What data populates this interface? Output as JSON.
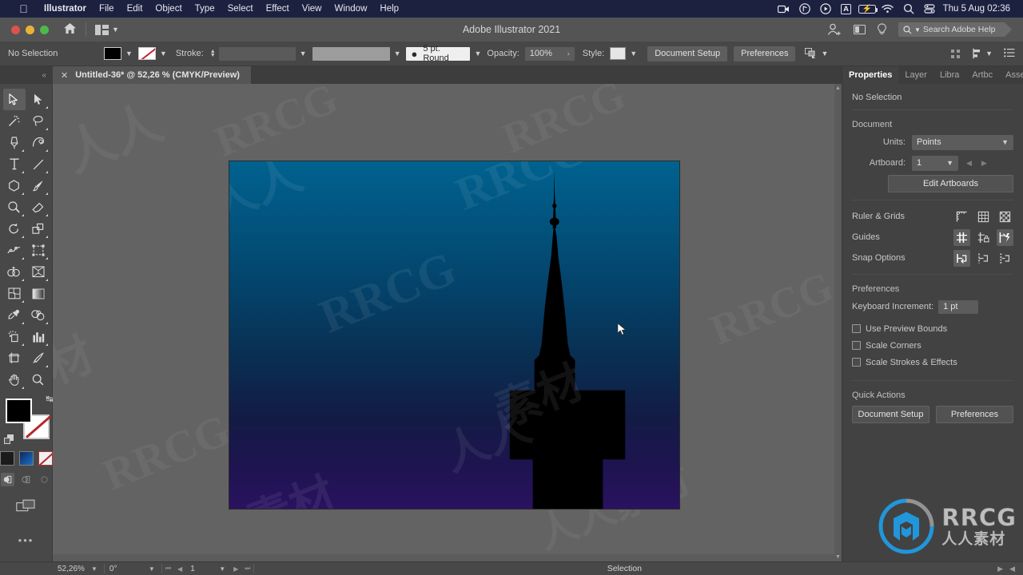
{
  "macbar": {
    "apple_icon": "apple-logo",
    "menus": [
      "Illustrator",
      "File",
      "Edit",
      "Object",
      "Type",
      "Select",
      "Effect",
      "View",
      "Window",
      "Help"
    ],
    "status_icons": [
      "screen-record-icon",
      "music-app-icon",
      "play-circle-icon",
      "input-source-a-icon",
      "battery-charging-icon",
      "wifi-icon",
      "spotlight-search-icon",
      "control-center-icon"
    ],
    "clock": "Thu 5 Aug  02:36"
  },
  "titlebar": {
    "window_controls": [
      "close-button",
      "minimize-button",
      "zoom-button"
    ],
    "home_icon": "home-icon",
    "arrange_icon": "arrange-documents-icon",
    "title": "Adobe Illustrator 2021",
    "account_icon": "account-add-icon",
    "workspace_icon": "workspace-switcher-icon",
    "tips_icon": "lightbulb-icon",
    "search_placeholder": "Search Adobe Help",
    "search_value": ""
  },
  "controlbar": {
    "selection_status": "No Selection",
    "fill_swatch": "#000000",
    "stroke_swatch": "none",
    "stroke_label": "Stroke:",
    "stroke_weight": "",
    "stroke_profile": "",
    "brush_label": "5 pt. Round",
    "opacity_label": "Opacity:",
    "opacity_value": "100%",
    "style_label": "Style:",
    "document_setup_button": "Document Setup",
    "preferences_button": "Preferences",
    "align_icon": "align-objects-icon",
    "arrange_icon": "arrange-icon",
    "more_options_icon": "more-options-icon"
  },
  "tabbar": {
    "close_icon": "close-tab-icon",
    "doc_title": "Untitled-36* @ 52,26 % (CMYK/Preview)"
  },
  "toolbar": {
    "tools": [
      {
        "name": "selection-tool",
        "active": true
      },
      {
        "name": "direct-selection-tool",
        "active": false
      },
      {
        "name": "magic-wand-tool",
        "active": false
      },
      {
        "name": "lasso-tool",
        "active": false
      },
      {
        "name": "pen-tool",
        "active": false
      },
      {
        "name": "curvature-tool",
        "active": false
      },
      {
        "name": "type-tool",
        "active": false
      },
      {
        "name": "line-segment-tool",
        "active": false
      },
      {
        "name": "rectangle-tool",
        "active": false
      },
      {
        "name": "paintbrush-tool",
        "active": false
      },
      {
        "name": "shaper-tool",
        "active": false
      },
      {
        "name": "eraser-tool",
        "active": false
      },
      {
        "name": "rotate-tool",
        "active": false
      },
      {
        "name": "scale-tool",
        "active": false
      },
      {
        "name": "width-tool",
        "active": false
      },
      {
        "name": "free-transform-tool",
        "active": false
      },
      {
        "name": "shape-builder-tool",
        "active": false
      },
      {
        "name": "perspective-grid-tool",
        "active": false
      },
      {
        "name": "mesh-tool",
        "active": false
      },
      {
        "name": "gradient-tool",
        "active": false
      },
      {
        "name": "eyedropper-tool",
        "active": false
      },
      {
        "name": "blend-tool",
        "active": false
      },
      {
        "name": "symbol-sprayer-tool",
        "active": false
      },
      {
        "name": "column-graph-tool",
        "active": false
      },
      {
        "name": "artboard-tool",
        "active": false
      },
      {
        "name": "slice-tool",
        "active": false
      },
      {
        "name": "hand-tool",
        "active": false
      },
      {
        "name": "zoom-tool",
        "active": false
      }
    ],
    "fill_color": "#000000",
    "stroke_color": "none",
    "swatches": [
      "#1b1b1b",
      "gradient-blue",
      "none"
    ],
    "draw_modes": [
      "draw-normal",
      "draw-behind",
      "draw-inside"
    ],
    "screen_mode_icon": "screen-mode-icon",
    "edit_toolbar_icon": "edit-toolbar-dots"
  },
  "canvas": {
    "artboard_width": 565,
    "artboard_height": 437,
    "gradient_top": "#00628f",
    "gradient_bottom": "#2a1260",
    "artwork_name": "church-spire-silhouette",
    "silhouette_color": "#000000",
    "cursor": "arrow-cursor",
    "watermark_text": "RRCG",
    "watermark_text_cn": "人人素材"
  },
  "properties": {
    "tabs": [
      {
        "label": "Properties",
        "active": true
      },
      {
        "label": "Layer",
        "active": false
      },
      {
        "label": "Libra",
        "active": false
      },
      {
        "label": "Artbc",
        "active": false
      },
      {
        "label": "Asse",
        "active": false
      }
    ],
    "no_selection": "No Selection",
    "document_section": "Document",
    "units_label": "Units:",
    "units_value": "Points",
    "artboard_label": "Artboard:",
    "artboard_value": "1",
    "prev_artboard_icon": "prev-artboard-icon",
    "next_artboard_icon": "next-artboard-icon",
    "edit_artboards_button": "Edit Artboards",
    "ruler_grids_label": "Ruler & Grids",
    "ruler_grids_icons": [
      "show-rulers-icon",
      "show-grid-icon",
      "show-transparency-grid-icon"
    ],
    "guides_label": "Guides",
    "guides_icons": [
      "show-guides-icon",
      "lock-guides-icon",
      "smart-guides-icon"
    ],
    "snap_options_label": "Snap Options",
    "snap_icons": [
      "snap-to-point-icon",
      "snap-to-grid-icon",
      "snap-to-pixel-icon"
    ],
    "preferences_section": "Preferences",
    "keyboard_increment_label": "Keyboard Increment:",
    "keyboard_increment_value": "1 pt",
    "checkboxes": [
      {
        "label": "Use Preview Bounds",
        "checked": false
      },
      {
        "label": "Scale Corners",
        "checked": false
      },
      {
        "label": "Scale Strokes & Effects",
        "checked": false
      }
    ],
    "quick_actions_section": "Quick Actions",
    "quick_actions": [
      "Document Setup",
      "Preferences"
    ],
    "logo_primary": "RRCG",
    "logo_secondary": "人人素材",
    "logo_accent_color": "#1f9ee8"
  },
  "statusbar": {
    "zoom_value": "52,26%",
    "rotate_value": "0°",
    "first_icon": "first-artboard-icon",
    "prev_icon": "prev-artboard-icon",
    "artboard_number": "1",
    "next_icon": "next-artboard-icon",
    "last_icon": "last-artboard-icon",
    "status_text": "Selection",
    "play_icon": "play-icon",
    "resize_icon": "resize-grip-icon"
  }
}
